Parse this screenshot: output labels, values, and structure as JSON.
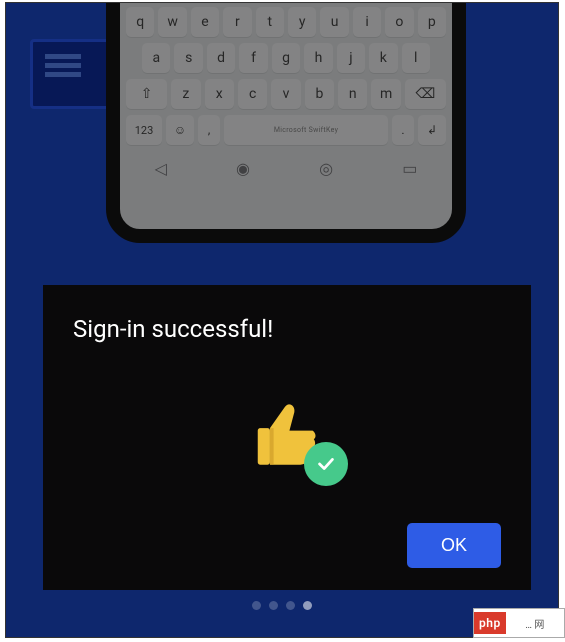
{
  "keyboard": {
    "row1": [
      "q",
      "w",
      "e",
      "r",
      "t",
      "y",
      "u",
      "i",
      "o",
      "p"
    ],
    "row2": [
      "a",
      "s",
      "d",
      "f",
      "g",
      "h",
      "j",
      "k",
      "l"
    ],
    "row3_mid": [
      "z",
      "x",
      "c",
      "v",
      "b",
      "n",
      "m"
    ],
    "shift_glyph": "⇧",
    "backspace_glyph": "⌫",
    "num_label": "123",
    "emoji_glyph": "☺",
    "comma": ",",
    "space_label": "Microsoft SwiftKey",
    "dot": ".",
    "enter_glyph": "↲",
    "nav_back": "◁",
    "nav_home": "◉",
    "nav_recent": "◎",
    "nav_kbd": "▭"
  },
  "dialog": {
    "title": "Sign-in successful!",
    "ok_label": "OK"
  },
  "pager": {
    "count": 4,
    "active_index": 3
  },
  "watermark": {
    "brand": "php",
    "suffix": "… 网"
  }
}
